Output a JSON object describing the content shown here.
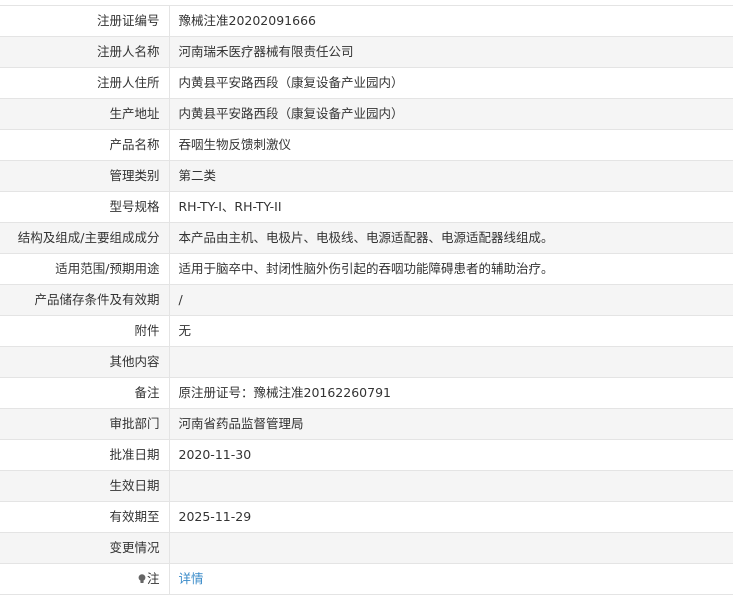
{
  "rows": [
    {
      "label": "注册证编号",
      "value": "豫械注准20202091666"
    },
    {
      "label": "注册人名称",
      "value": "河南瑞禾医疗器械有限责任公司"
    },
    {
      "label": "注册人住所",
      "value": "内黄县平安路西段（康复设备产业园内）"
    },
    {
      "label": "生产地址",
      "value": "内黄县平安路西段（康复设备产业园内）"
    },
    {
      "label": "产品名称",
      "value": "吞咽生物反馈刺激仪"
    },
    {
      "label": "管理类别",
      "value": "第二类"
    },
    {
      "label": "型号规格",
      "value": "RH-TY-I、RH-TY-II"
    },
    {
      "label": "结构及组成/主要组成成分",
      "value": "本产品由主机、电极片、电极线、电源适配器、电源适配器线组成。"
    },
    {
      "label": "适用范围/预期用途",
      "value": "适用于脑卒中、封闭性脑外伤引起的吞咽功能障碍患者的辅助治疗。"
    },
    {
      "label": "产品储存条件及有效期",
      "value": "/"
    },
    {
      "label": "附件",
      "value": "无"
    },
    {
      "label": "其他内容",
      "value": ""
    },
    {
      "label": "备注",
      "value": "原注册证号：豫械注准20162260791"
    },
    {
      "label": "审批部门",
      "value": "河南省药品监督管理局"
    },
    {
      "label": "批准日期",
      "value": "2020-11-30"
    },
    {
      "label": "生效日期",
      "value": ""
    },
    {
      "label": "有效期至",
      "value": "2025-11-29"
    },
    {
      "label": "变更情况",
      "value": ""
    }
  ],
  "note": {
    "label": "注",
    "icon": "lightbulb-icon",
    "link_text": "详情",
    "link_color": "#3a8bc9"
  }
}
